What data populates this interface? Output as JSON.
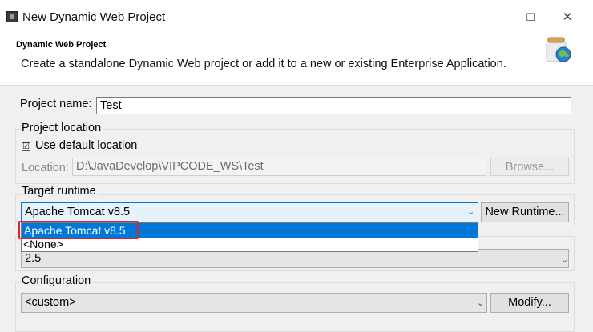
{
  "window": {
    "title": "New Dynamic Web Project",
    "controls": {
      "minimize": "—",
      "maximize": "☐",
      "close": "✕"
    }
  },
  "header": {
    "title": "Dynamic Web Project",
    "description": "Create a standalone Dynamic Web project or add it to a new or existing Enterprise Application.",
    "icon": "globe-jar-icon"
  },
  "form": {
    "project_name": {
      "label": "Project name:",
      "value": "Test"
    },
    "project_location": {
      "legend": "Project location",
      "use_default": {
        "label": "Use default location",
        "checked": true,
        "mark": "☑"
      },
      "location": {
        "label": "Location:",
        "value": "D:\\JavaDevelop\\VIPCODE_WS\\Test"
      },
      "browse_label": "Browse..."
    },
    "target_runtime": {
      "legend": "Target runtime",
      "selected": "Apache Tomcat v8.5",
      "options": [
        "Apache Tomcat v8.5",
        "<None>"
      ],
      "new_runtime_label": "New Runtime..."
    },
    "module_version": {
      "value": "2.5"
    },
    "configuration": {
      "legend": "Configuration",
      "value": "<custom>",
      "modify_label": "Modify..."
    },
    "chevron": "⌄"
  },
  "colors": {
    "selection": "#0078d7",
    "highlight_annotation": "#e0202a",
    "form_background": "#f0f0f0"
  }
}
